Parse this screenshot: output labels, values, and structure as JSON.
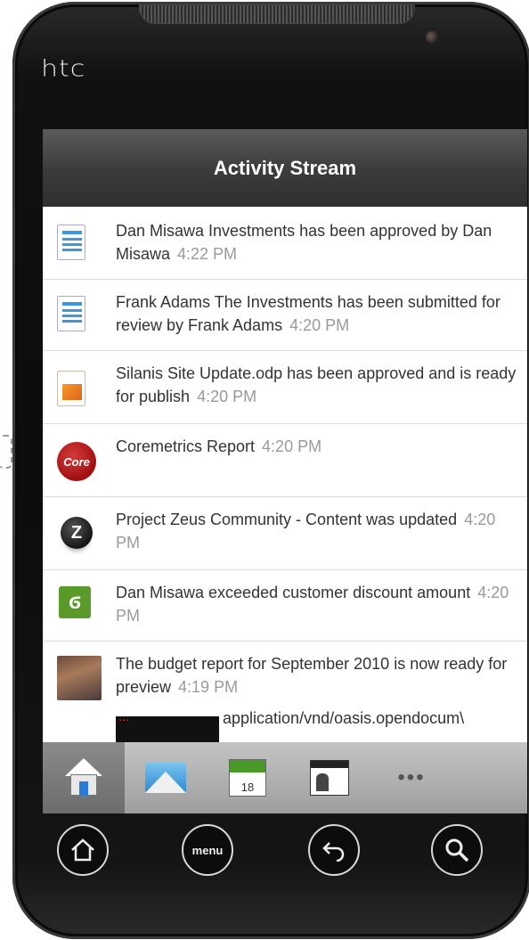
{
  "device": {
    "brand": "htc"
  },
  "header": {
    "title": "Activity Stream"
  },
  "activity": [
    {
      "icon": "document-icon",
      "text": "Dan Misawa Investments has been approved by Dan Misawa",
      "time": "4:22 PM"
    },
    {
      "icon": "document-icon",
      "text": "Frank Adams The Investments has been submitted for review by Frank Adams",
      "time": "4:20 PM"
    },
    {
      "icon": "presentation-icon",
      "text": "Silanis Site Update.odp has been approved and is ready for publish",
      "time": "4:20 PM"
    },
    {
      "icon": "coremetrics-logo",
      "logo_text": "Core",
      "text": "Coremetrics Report",
      "time": "4:20 PM"
    },
    {
      "icon": "zeus-logo",
      "logo_text": "Z",
      "text": "Project Zeus Community - Content was updated",
      "time": "4:20 PM"
    },
    {
      "icon": "discount-icon",
      "text": "Dan Misawa exceeded customer discount amount",
      "time": "4:20 PM"
    },
    {
      "icon": "user-photo",
      "text": "The budget report for September 2010 is now ready for preview",
      "time": "4:19 PM",
      "attachment": "application/vnd/oasis.opendocum\\"
    }
  ],
  "tabs": [
    {
      "name": "home",
      "icon": "home-icon"
    },
    {
      "name": "mail",
      "icon": "mail-icon"
    },
    {
      "name": "calendar",
      "icon": "calendar-icon",
      "day": "18"
    },
    {
      "name": "contacts",
      "icon": "contacts-icon"
    },
    {
      "name": "more",
      "icon": "more-icon",
      "label": "•••"
    }
  ],
  "hardware_buttons": {
    "menu_label": "menu"
  },
  "colors": {
    "title_bar": "#3d3d3d",
    "tab_bar": "#b0b0b0",
    "time_text": "#9a9a9a"
  }
}
